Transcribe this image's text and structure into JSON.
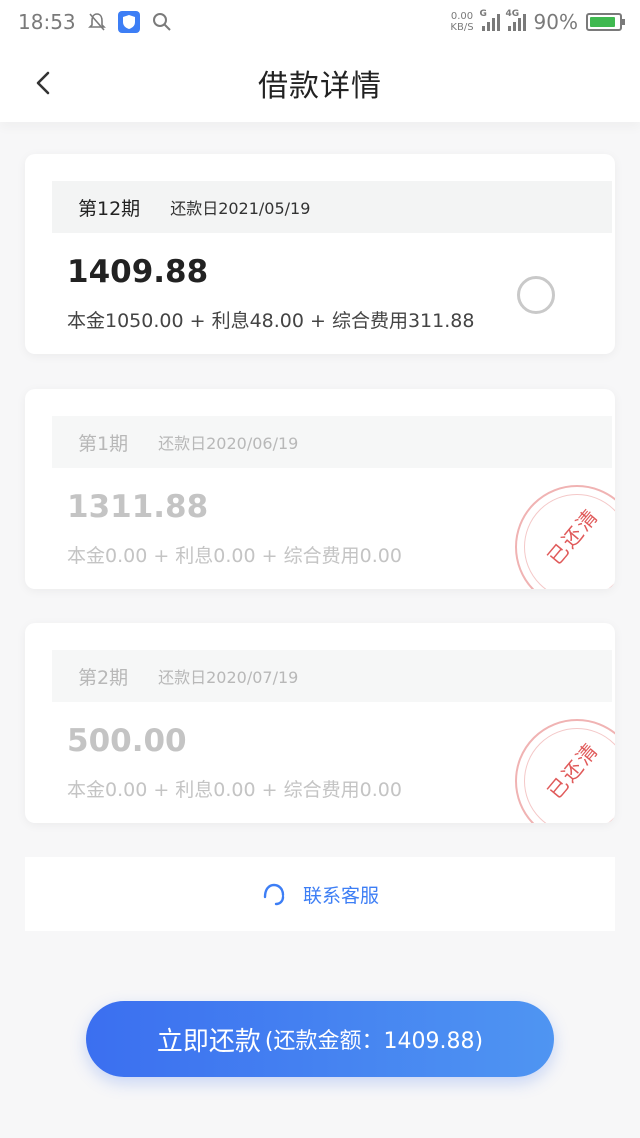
{
  "status_bar": {
    "time": "18:53",
    "net_speed_value": "0.00",
    "net_speed_unit": "KB/S",
    "signal_1_tag": "G",
    "signal_2_tag": "4G",
    "battery_text": "90%",
    "battery_level": 0.9,
    "icons": [
      "bell-off-icon",
      "shield-icon",
      "search-icon",
      "signal-icon",
      "battery-icon"
    ]
  },
  "header": {
    "title": "借款详情",
    "back_icon": "chevron-left-icon"
  },
  "installments": [
    {
      "period": "第12期",
      "due_date": "还款日2021/05/19",
      "amount": "1409.88",
      "breakdown": "本金1050.00 + 利息48.00 + 综合费用311.88",
      "status": "unpaid"
    },
    {
      "period": "第1期",
      "due_date": "还款日2020/06/19",
      "amount": "1311.88",
      "breakdown": "本金0.00 + 利息0.00 + 综合费用0.00",
      "status": "paid",
      "stamp": "已还清"
    },
    {
      "period": "第2期",
      "due_date": "还款日2020/07/19",
      "amount": "500.00",
      "breakdown": "本金0.00 + 利息0.00 + 综合费用0.00",
      "status": "paid",
      "stamp": "已还清"
    }
  ],
  "service": {
    "label": "联系客服",
    "icon": "headset-icon"
  },
  "pay_button": {
    "label": "立即还款",
    "detail": "(还款金额：1409.88)"
  },
  "colors": {
    "accent": "#3d7ef5",
    "stamp": "#e05a5a",
    "button_start": "#3b6ff0",
    "button_end": "#4f95f2"
  }
}
